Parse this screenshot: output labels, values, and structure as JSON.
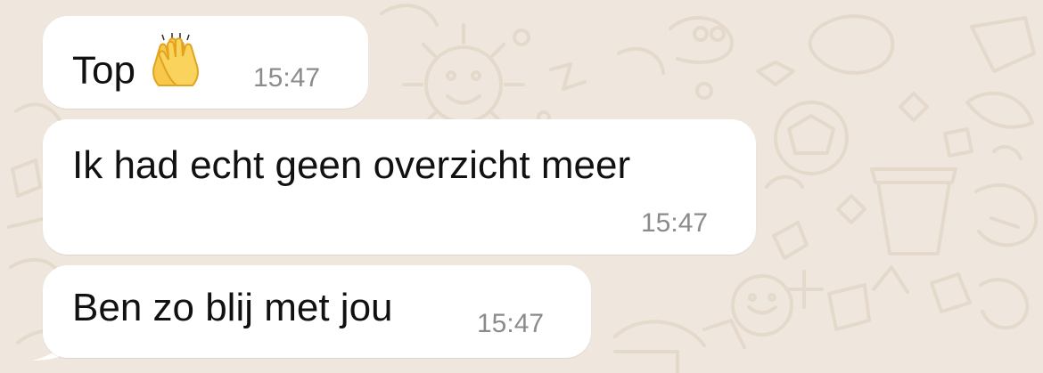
{
  "chat": {
    "messages": [
      {
        "text": "Top",
        "emoji": "raising-hands-icon",
        "time": "15:47"
      },
      {
        "text": "Ik had echt geen overzicht meer",
        "time": "15:47"
      },
      {
        "text": "Ben zo blij met jou",
        "time": "15:47"
      }
    ]
  },
  "colors": {
    "wallpaper": "#efe7dd",
    "bubble": "#ffffff",
    "message_text": "#111111",
    "timestamp": "#8b8b8b"
  }
}
